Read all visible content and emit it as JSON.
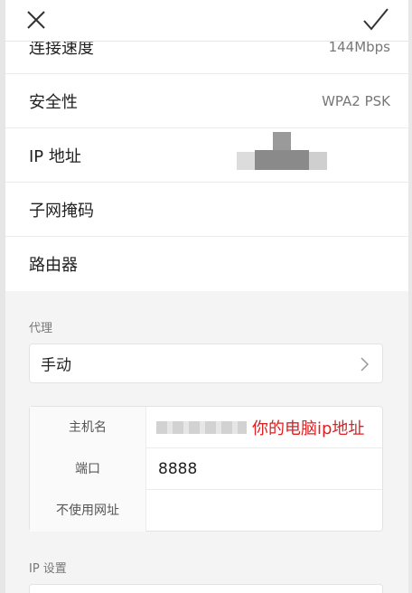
{
  "colors": {
    "accent_red": "#e02020",
    "background": "#f4f4f4",
    "card": "#ffffff",
    "muted_text": "#777777"
  },
  "topbar": {
    "close_icon": "close-icon",
    "confirm_icon": "check-icon"
  },
  "network_info": {
    "rows": [
      {
        "label": "连接速度",
        "value": "144Mbps"
      },
      {
        "label": "安全性",
        "value": "WPA2 PSK"
      },
      {
        "label": "IP 地址",
        "value": ""
      },
      {
        "label": "子网掩码",
        "value": ""
      },
      {
        "label": "路由器",
        "value": ""
      }
    ]
  },
  "proxy": {
    "section_title": "代理",
    "mode_label": "手动",
    "rows": [
      {
        "key": "主机名",
        "value": "",
        "annotation": "你的电脑ip地址"
      },
      {
        "key": "端口",
        "value": "8888"
      },
      {
        "key": "不使用网址",
        "value": ""
      }
    ]
  },
  "ip_settings": {
    "section_title": "IP 设置"
  }
}
